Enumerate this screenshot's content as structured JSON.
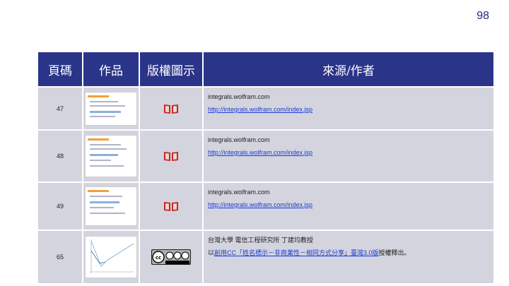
{
  "page_number": "98",
  "table": {
    "headers": {
      "page": "頁碼",
      "work": "作品",
      "license": "版權圖示",
      "source": "來源/作者"
    },
    "rows": [
      {
        "page": "47",
        "source_name": "integrals.wolfram.com",
        "source_url": "http://integrals.wolfram.com/index.jsp",
        "icon": "book-icon"
      },
      {
        "page": "48",
        "source_name": "integrals.wolfram.com",
        "source_url": "http://integrals.wolfram.com/index.jsp",
        "icon": "book-icon"
      },
      {
        "page": "49",
        "source_name": "integrals.wolfram.com",
        "source_url": "http://integrals.wolfram.com/index.jsp",
        "icon": "book-icon"
      },
      {
        "page": "65",
        "source_name": "台灣大學 電信工程研究所 丁建均教授",
        "license_prefix": "以",
        "license_link": "創用CC「姓名標示－非商業性－相同方式分享」臺灣3.0版",
        "license_suffix": "授權釋出。",
        "icon": "cc-by-nc-sa-icon"
      }
    ]
  },
  "colors": {
    "header_bg": "#2a3488",
    "row_bg": "#d3d4de",
    "link": "#1a3bd6",
    "book_icon": "#c0282d"
  }
}
